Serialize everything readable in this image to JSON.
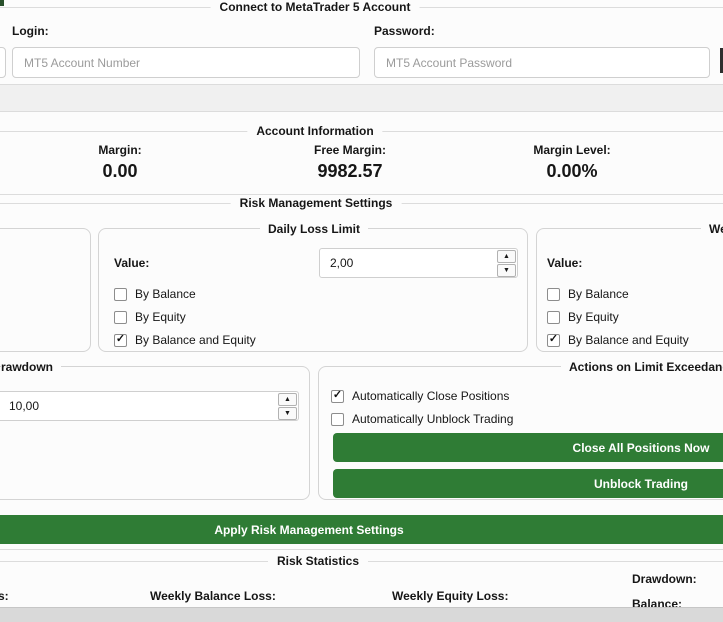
{
  "colors": {
    "accent_green": "#2f7c35",
    "page_background": "#fcfcfc",
    "divider_line": "#dcdcdc",
    "gray_band": "#f0f0f0",
    "bottom_band": "#d9d9d9"
  },
  "icons": {
    "check": "✓",
    "spinner_up": "▲",
    "spinner_down": "▼"
  },
  "connect": {
    "title": "Connect to MetaTrader 5 Account",
    "login_label": "Login:",
    "login_placeholder": "MT5 Account Number",
    "login_value": "",
    "password_label": "Password:",
    "password_placeholder": "MT5 Account Password",
    "password_value": ""
  },
  "account_info": {
    "title": "Account Information",
    "stats": [
      {
        "label": "Margin:",
        "value": "0.00"
      },
      {
        "label": "Free Margin:",
        "value": "9982.57"
      },
      {
        "label": "Margin Level:",
        "value": "0.00%"
      }
    ]
  },
  "risk_settings": {
    "title": "Risk Management Settings",
    "daily": {
      "title": "Daily Loss Limit",
      "value_label": "Value:",
      "value": "2,00",
      "checkboxes": [
        {
          "label": "By Balance",
          "checked": false
        },
        {
          "label": "By Equity",
          "checked": false
        },
        {
          "label": "By Balance and Equity",
          "checked": true
        }
      ]
    },
    "weekly": {
      "title_visible": "Wee",
      "value_label": "Value:",
      "checkboxes": [
        {
          "label": "By Balance",
          "checked": false
        },
        {
          "label": "By Equity",
          "checked": false
        },
        {
          "label": "By Balance and Equity",
          "checked": true
        }
      ]
    },
    "drawdown": {
      "title_visible": "rawdown",
      "value": "10,00"
    },
    "actions": {
      "title": "Actions on Limit Exceedance",
      "checkboxes": [
        {
          "label": "Automatically Close Positions",
          "checked": true
        },
        {
          "label": "Automatically Unblock Trading",
          "checked": false
        }
      ],
      "close_all_button": "Close All Positions Now",
      "unblock_button": "Unblock Trading"
    },
    "apply_button": "Apply Risk Management Settings"
  },
  "risk_stats": {
    "title": "Risk Statistics",
    "cutoff_label_visible": "s:",
    "weekly_balance_label": "Weekly Balance Loss:",
    "weekly_equity_label": "Weekly Equity Loss:",
    "drawdown_label": "Drawdown:",
    "balance_label": "Balance:"
  }
}
